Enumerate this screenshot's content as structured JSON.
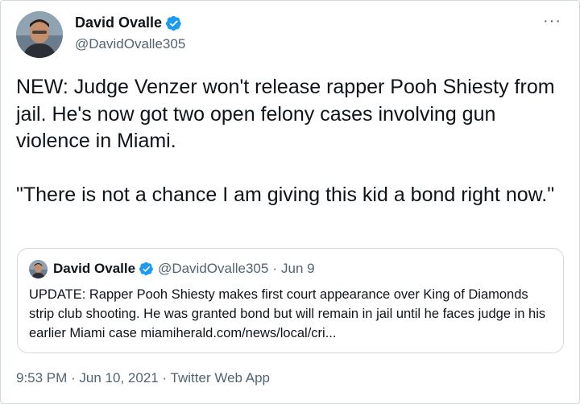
{
  "author": {
    "name": "David Ovalle",
    "handle": "@DavidOvalle305",
    "avatar_icon": "profile-photo",
    "verified_icon": "verified-badge-icon"
  },
  "more_icon_text": "···",
  "tweet": {
    "paragraph1": "NEW: Judge Venzer won't release rapper Pooh Shiesty from jail. He's now got two open felony cases involving gun violence in Miami.",
    "paragraph2": "\"There is not a chance I am giving this kid a bond right now.\""
  },
  "quoted_tweet": {
    "name": "David Ovalle",
    "handle": "@DavidOvalle305",
    "separator": "·",
    "date": "Jun 9",
    "text": "UPDATE: Rapper Pooh Shiesty makes first court appearance over King of Diamonds strip club shooting. He was granted bond but will remain in jail until he faces judge in his earlier Miami case miamiherald.com/news/local/cri..."
  },
  "meta": {
    "time": "9:53 PM",
    "sep1": " · ",
    "date": "Jun 10, 2021",
    "sep2": " · ",
    "source": "Twitter Web App"
  },
  "colors": {
    "verified_blue": "#1d9bf0",
    "secondary_text": "#536471",
    "border": "#cfd9de"
  }
}
